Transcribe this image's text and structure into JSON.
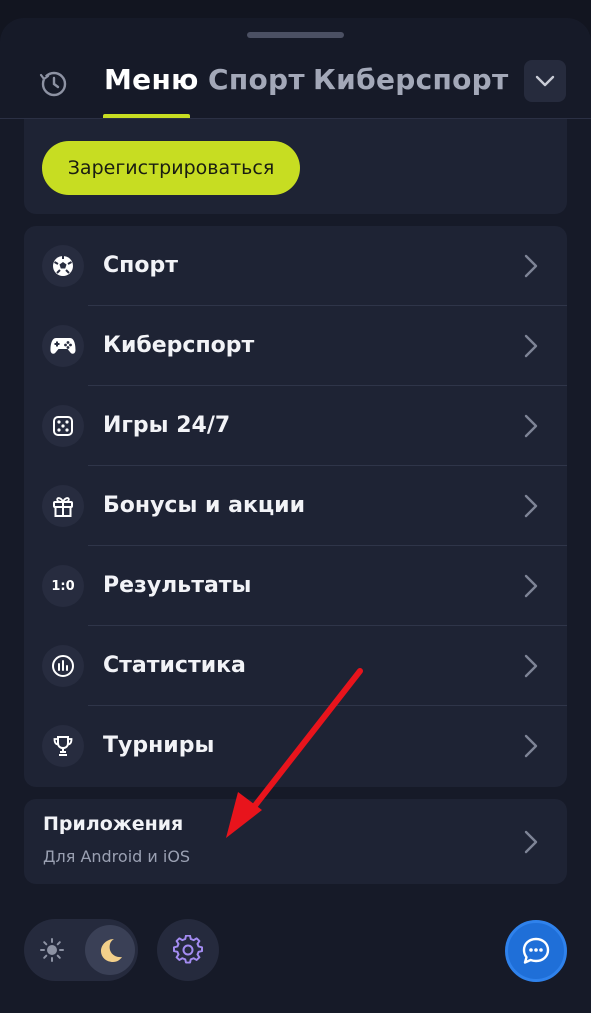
{
  "header": {
    "tabs": [
      {
        "label": "Меню",
        "active": true
      },
      {
        "label": "Спорт",
        "active": false
      },
      {
        "label": "Киберспорт",
        "active": false
      }
    ],
    "history_icon": "history-clock-icon",
    "collapse_icon": "chevron-down-icon"
  },
  "register": {
    "label": "Зарегистрироваться"
  },
  "menu": {
    "items": [
      {
        "label": "Спорт",
        "icon": "soccer-ball-icon"
      },
      {
        "label": "Киберспорт",
        "icon": "gamepad-icon"
      },
      {
        "label": "Игры 24/7",
        "icon": "dice-icon"
      },
      {
        "label": "Бонусы и акции",
        "icon": "gift-icon"
      },
      {
        "label": "Результаты",
        "icon": "score-icon",
        "icon_text": "1:0"
      },
      {
        "label": "Статистика",
        "icon": "statistics-icon"
      },
      {
        "label": "Турниры",
        "icon": "trophy-icon"
      }
    ]
  },
  "apps": {
    "title": "Приложения",
    "subtitle": "Для Android и iOS"
  },
  "footer": {
    "theme": "dark",
    "light_icon": "sun-icon",
    "dark_icon": "moon-icon",
    "settings_icon": "gear-icon",
    "chat_icon": "chat-bubble-icon"
  },
  "colors": {
    "accent": "#c7dd22",
    "background": "#161a28",
    "card": "#1e2334",
    "chat": "#1f6fd8",
    "annotation_arrow": "#e8141c"
  }
}
